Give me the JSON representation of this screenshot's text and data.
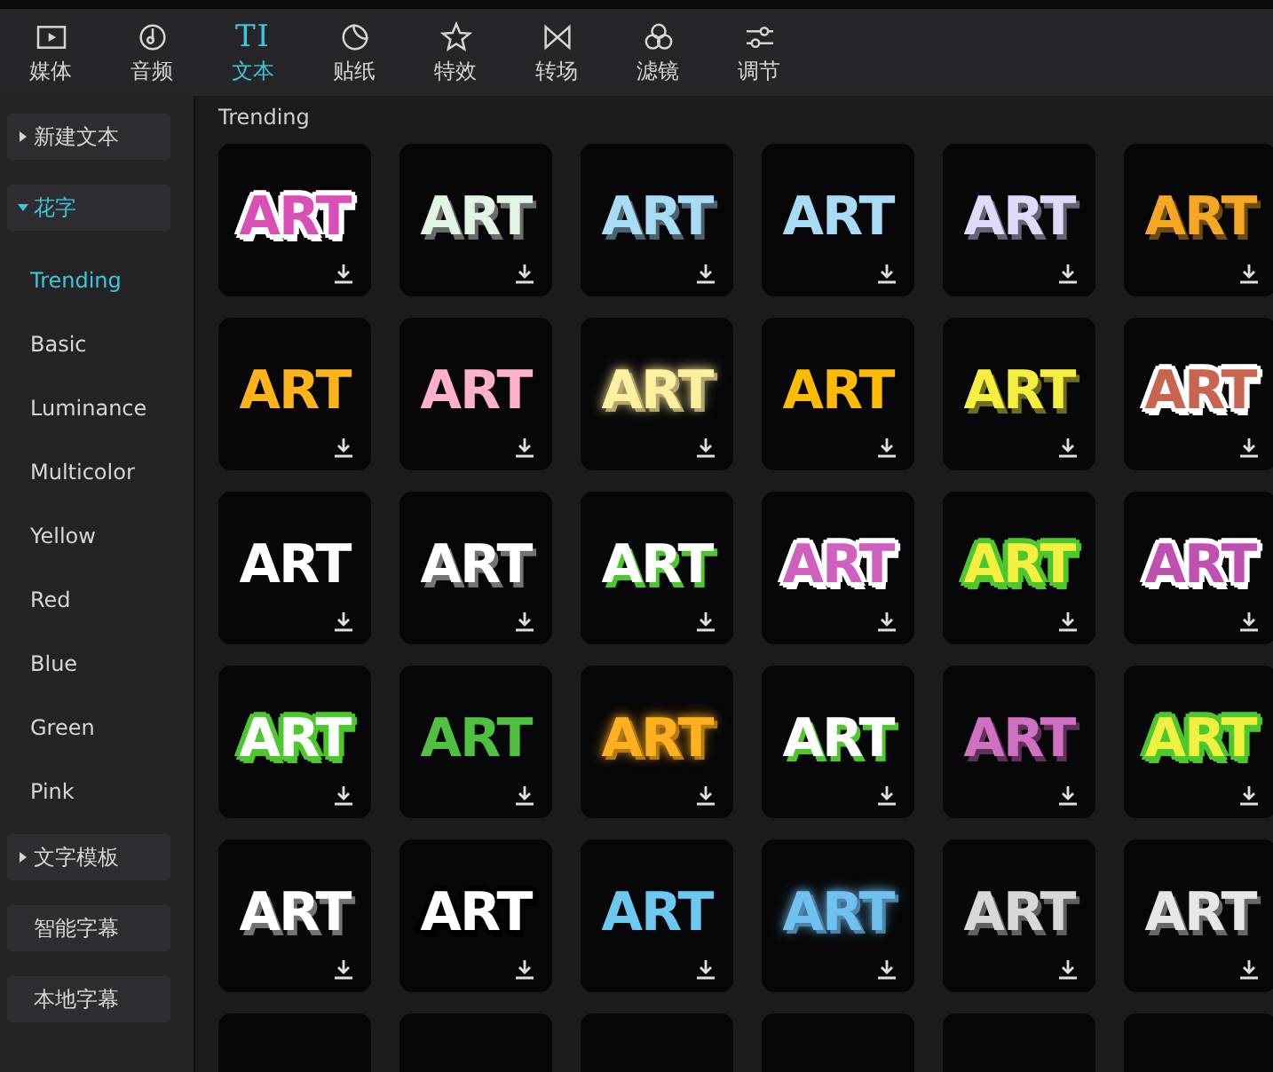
{
  "toolbar": {
    "tabs": [
      {
        "label": "媒体",
        "kind": "media",
        "selected": false
      },
      {
        "label": "音频",
        "kind": "audio",
        "selected": false
      },
      {
        "label": "文本",
        "kind": "text",
        "icon_text": "TI",
        "selected": true
      },
      {
        "label": "贴纸",
        "kind": "sticker",
        "selected": false
      },
      {
        "label": "特效",
        "kind": "effect",
        "selected": false
      },
      {
        "label": "转场",
        "kind": "transition",
        "selected": false
      },
      {
        "label": "滤镜",
        "kind": "filter",
        "selected": false
      },
      {
        "label": "调节",
        "kind": "adjust",
        "selected": false
      }
    ]
  },
  "sidebar": {
    "items": [
      {
        "label": "新建文本",
        "expandable": true,
        "expanded": false,
        "selected": false
      },
      {
        "label": "花字",
        "expandable": true,
        "expanded": true,
        "selected": true,
        "children": [
          {
            "label": "Trending",
            "selected": true
          },
          {
            "label": "Basic",
            "selected": false
          },
          {
            "label": "Luminance",
            "selected": false
          },
          {
            "label": "Multicolor",
            "selected": false
          },
          {
            "label": "Yellow",
            "selected": false
          },
          {
            "label": "Red",
            "selected": false
          },
          {
            "label": "Blue",
            "selected": false
          },
          {
            "label": "Green",
            "selected": false
          },
          {
            "label": "Pink",
            "selected": false
          }
        ]
      },
      {
        "label": "文字模板",
        "expandable": true,
        "expanded": false,
        "selected": false
      },
      {
        "label": "智能字幕",
        "expandable": false,
        "expanded": false,
        "selected": false
      },
      {
        "label": "本地字幕",
        "expandable": false,
        "expanded": false,
        "selected": false
      }
    ]
  },
  "content": {
    "heading": "Trending",
    "tiles": [
      {
        "text": "ART",
        "kind": "outline",
        "color": "#d94fb5"
      },
      {
        "text": "ART",
        "kind": "shadow",
        "color": "#e2f4e4"
      },
      {
        "text": "ART",
        "kind": "shadow",
        "color": "#a8dcf5"
      },
      {
        "text": "ART",
        "kind": "plain",
        "color": "#a8dcf5"
      },
      {
        "text": "ART",
        "kind": "shadow",
        "color": "#dcdcfa"
      },
      {
        "text": "ART",
        "kind": "shadow",
        "color": "#f5a623"
      },
      {
        "text": "ART",
        "kind": "plain",
        "color": "#ffb31a"
      },
      {
        "text": "ART",
        "kind": "plain",
        "color": "#ffb0cc"
      },
      {
        "text": "ART",
        "kind": "glow",
        "color": "#fff0a0"
      },
      {
        "text": "ART",
        "kind": "plain",
        "color": "#ffbb00"
      },
      {
        "text": "ART",
        "kind": "shadow",
        "color": "#f5f040"
      },
      {
        "text": "ART",
        "kind": "outline",
        "color": "#c86450"
      },
      {
        "text": "ART",
        "kind": "plain",
        "color": "#ffffff"
      },
      {
        "text": "ART",
        "kind": "shadow",
        "color": "#ffffff"
      },
      {
        "text": "ART",
        "kind": "greenshadow",
        "color": "#ffffff"
      },
      {
        "text": "ART",
        "kind": "outline",
        "color": "#d060c0"
      },
      {
        "text": "ART",
        "kind": "halo",
        "color": "#f5f040"
      },
      {
        "text": "ART",
        "kind": "outline",
        "color": "#c050b0"
      },
      {
        "text": "ART",
        "kind": "halo",
        "color": "#ffffff"
      },
      {
        "text": "ART",
        "kind": "plain",
        "color": "#50c040"
      },
      {
        "text": "ART",
        "kind": "glow",
        "color": "#ffb020"
      },
      {
        "text": "ART",
        "kind": "greenshadow",
        "color": "#ffffff"
      },
      {
        "text": "ART",
        "kind": "shadow",
        "color": "#d070c0"
      },
      {
        "text": "ART",
        "kind": "halo",
        "color": "#f0f040"
      },
      {
        "text": "ART",
        "kind": "shadow",
        "color": "#ffffff"
      },
      {
        "text": "ART",
        "kind": "stroke",
        "color": "#ffffff"
      },
      {
        "text": "ART",
        "kind": "plain",
        "color": "#6cc8f0"
      },
      {
        "text": "ART",
        "kind": "glow",
        "color": "#70c0f0"
      },
      {
        "text": "ART",
        "kind": "shadow",
        "color": "#d8d8d8"
      },
      {
        "text": "ART",
        "kind": "shadow",
        "color": "#e6e6e6"
      }
    ]
  }
}
